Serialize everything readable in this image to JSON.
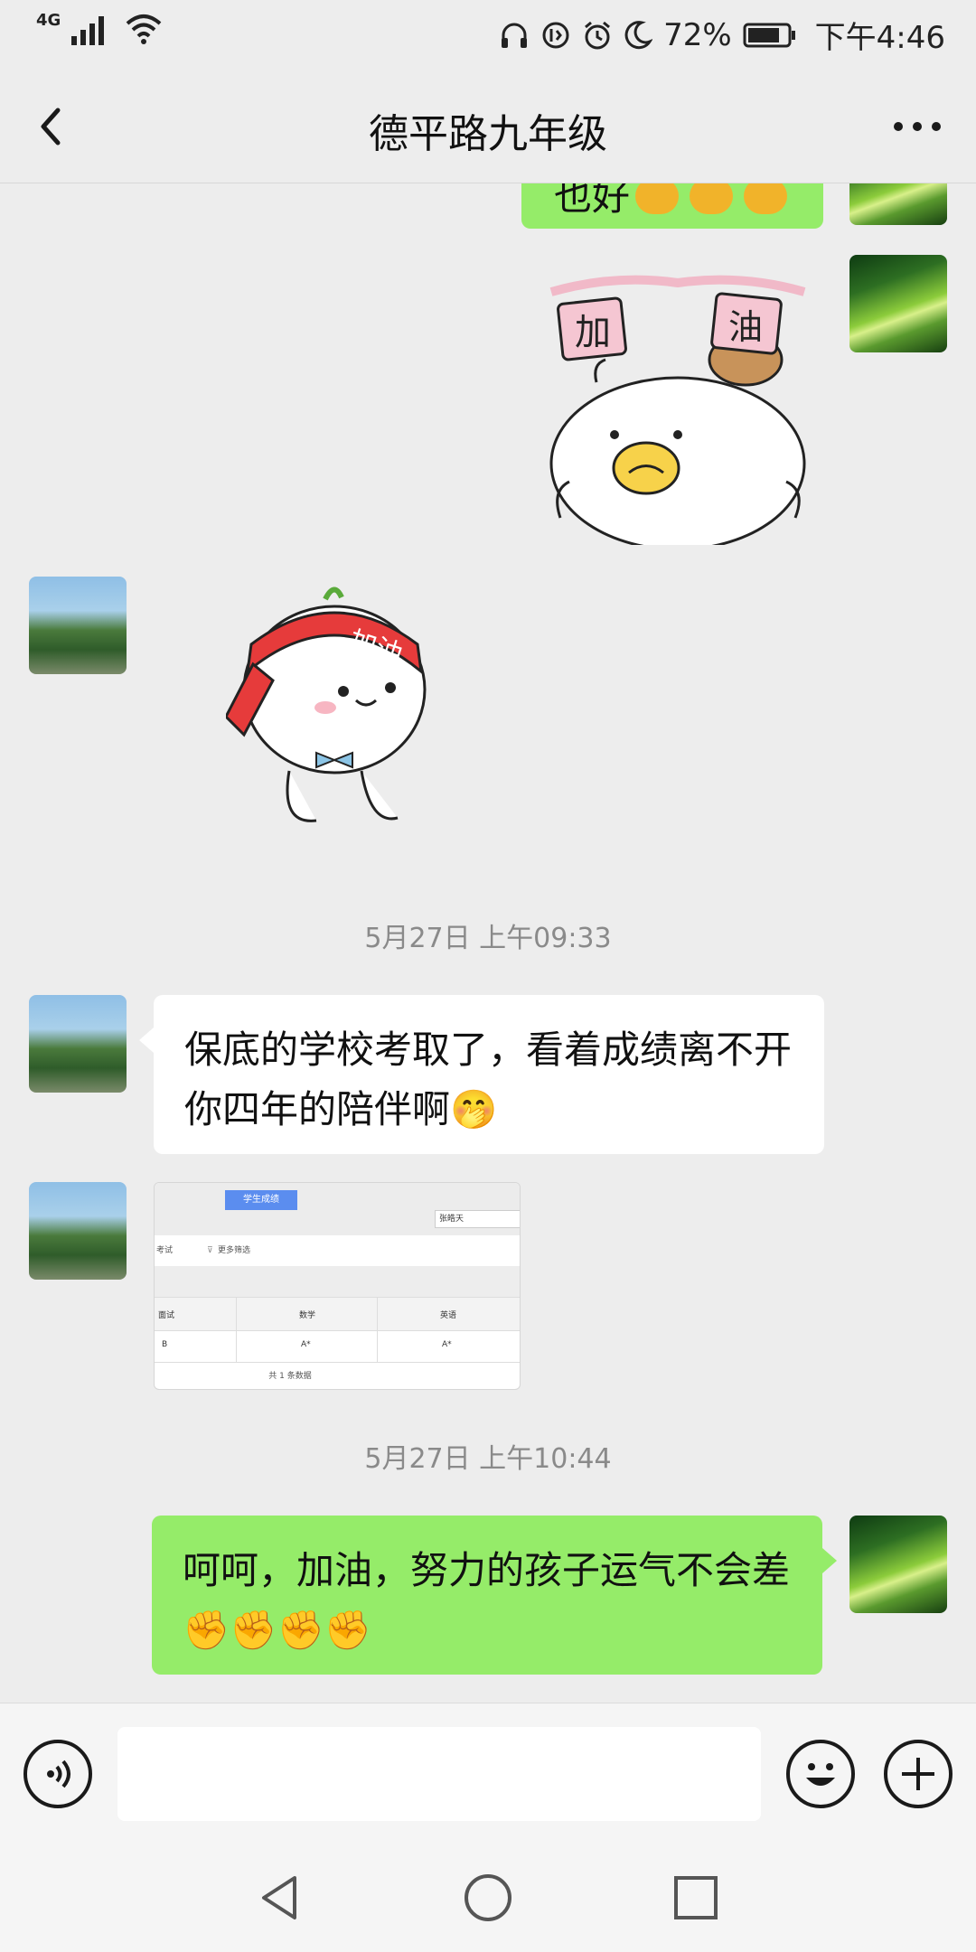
{
  "status_bar": {
    "network": "4G",
    "battery": "72%",
    "time": "下午4:46"
  },
  "header": {
    "title": "德平路九年级"
  },
  "messages": {
    "partial_top_text": "也好",
    "ts1": "5月27日 上午09:33",
    "msg_school": "保底的学校考取了，看着成绩离不开你四年的陪伴啊🤭",
    "ts2": "5月27日 上午10:44",
    "msg_reply": "呵呵，加油，努力的孩子运气不会差✊✊✊✊"
  },
  "sticker_text": {
    "banner_left": "加",
    "banner_right": "油",
    "headband": "加油"
  },
  "screenshot_image": {
    "tab_label": "学生成绩",
    "name_field": "张皓天",
    "filter_left": "考试",
    "filter_more": "更多筛选",
    "columns": [
      "面试",
      "数学",
      "英语"
    ],
    "row": [
      "B",
      "A*",
      "A*"
    ],
    "footer": "共 1 条数据"
  },
  "colors": {
    "green_bubble": "#95ec69",
    "background": "#ededed",
    "white_bubble": "#ffffff"
  }
}
